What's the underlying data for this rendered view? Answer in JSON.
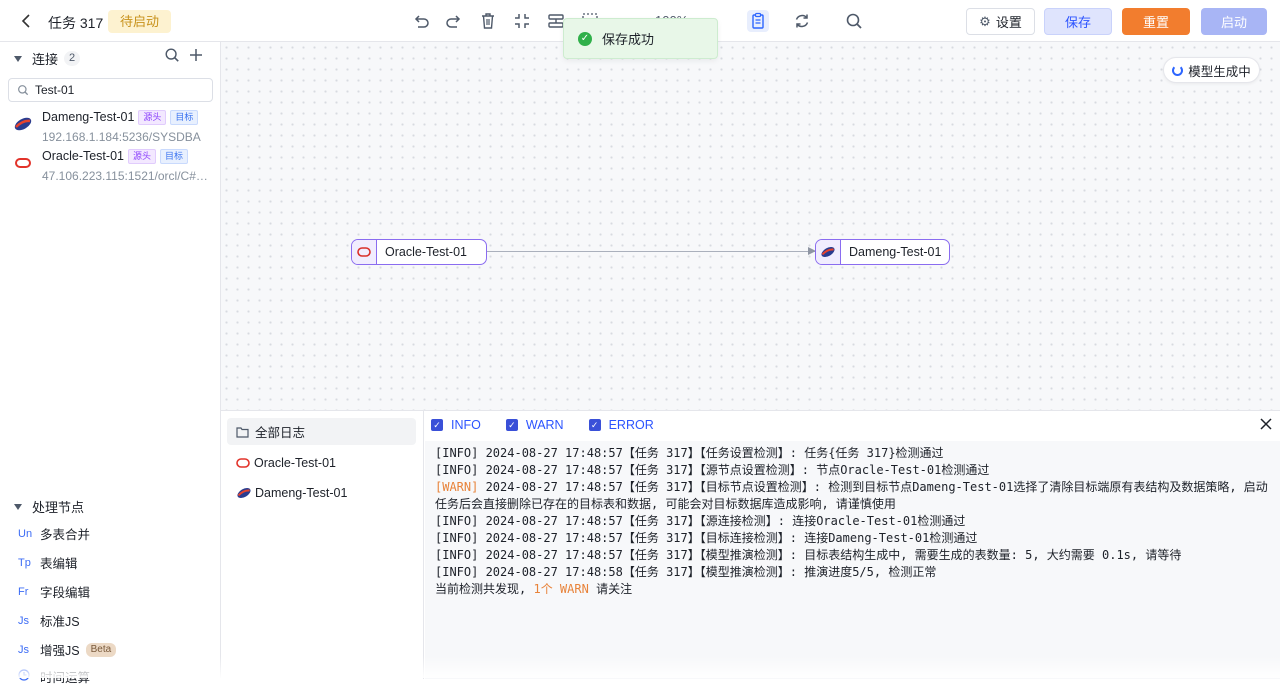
{
  "header": {
    "task_title": "任务 317",
    "status": "待启动",
    "zoom": "100%",
    "buttons": {
      "settings": "设置",
      "save": "保存",
      "reset": "重置",
      "start": "启动"
    }
  },
  "toast": {
    "message": "保存成功"
  },
  "sidebar": {
    "connections_title": "连接",
    "connections_count": "2",
    "search_value": "Test-01",
    "connections": [
      {
        "name": "Dameng-Test-01",
        "tag_src": "源头",
        "tag_dst": "目标",
        "address": "192.168.1.184:5236/SYSDBA"
      },
      {
        "name": "Oracle-Test-01",
        "tag_src": "源头",
        "tag_dst": "目标",
        "address": "47.106.223.115:1521/orcl/C##TA..."
      }
    ],
    "processing_title": "处理节点",
    "processing_nodes": [
      {
        "prefix": "Un",
        "label": "多表合并"
      },
      {
        "prefix": "Tp",
        "label": "表编辑"
      },
      {
        "prefix": "Fr",
        "label": "字段编辑"
      },
      {
        "prefix": "Js",
        "label": "标准JS"
      },
      {
        "prefix": "Js",
        "label": "增强JS",
        "badge": "Beta"
      },
      {
        "prefix": "",
        "label": "时间运算"
      }
    ]
  },
  "canvas": {
    "model_status": "模型生成中",
    "source_node": "Oracle-Test-01",
    "target_node": "Dameng-Test-01"
  },
  "logs": {
    "sidebar_items": [
      "全部日志",
      "Oracle-Test-01",
      "Dameng-Test-01"
    ],
    "filters": [
      "INFO",
      "WARN",
      "ERROR"
    ],
    "lines": [
      {
        "level": "[INFO]",
        "text": " 2024-08-27 17:48:57【任务 317】【任务设置检测】: 任务{任务 317}检测通过"
      },
      {
        "level": "[INFO]",
        "text": " 2024-08-27 17:48:57【任务 317】【源节点设置检测】: 节点Oracle-Test-01检测通过"
      },
      {
        "level": "[WARN]",
        "text": " 2024-08-27 17:48:57【任务 317】【目标节点设置检测】: 检测到目标节点Dameng-Test-01选择了清除目标端原有表结构及数据策略, 启动任务后会直接删除已存在的目标表和数据, 可能会对目标数据库造成影响, 请谨慎使用"
      },
      {
        "level": "[INFO]",
        "text": " 2024-08-27 17:48:57【任务 317】【源连接检测】: 连接Oracle-Test-01检测通过"
      },
      {
        "level": "[INFO]",
        "text": " 2024-08-27 17:48:57【任务 317】【目标连接检测】: 连接Dameng-Test-01检测通过"
      },
      {
        "level": "[INFO]",
        "text": " 2024-08-27 17:48:57【任务 317】【模型推演检测】: 目标表结构生成中, 需要生成的表数量: 5, 大约需要 0.1s, 请等待"
      },
      {
        "level": "[INFO]",
        "text": " 2024-08-27 17:48:58【任务 317】【模型推演检测】: 推演进度5/5, 检测正常"
      }
    ],
    "summary_prefix": "当前检测共发现,",
    "summary_warn": "1个 WARN",
    "summary_suffix": "请关注"
  },
  "colors": {
    "accent": "#2c54ff",
    "reset": "#f27d2e",
    "start": "#a8b5f5",
    "warn": "#e8833a",
    "status_tag_bg": "#fdf2d0"
  }
}
